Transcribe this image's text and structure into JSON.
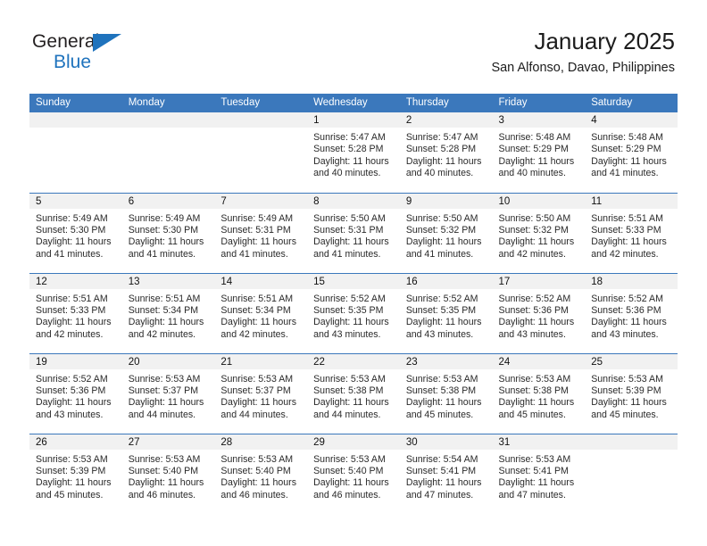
{
  "brand": {
    "name_line1": "General",
    "name_line2": "Blue",
    "triangle_icon": "triangle-icon",
    "color_dark": "#231f20",
    "color_blue": "#1f73bd"
  },
  "header": {
    "title": "January 2025",
    "subtitle": "San Alfonso, Davao, Philippines"
  },
  "theme": {
    "header_bg": "#3b78bc",
    "header_text": "#ffffff",
    "daynum_band_bg": "#f1f1f1",
    "cell_bg": "#ffffff",
    "divider": "#3b78bc"
  },
  "calendar": {
    "weekday_headers": [
      "Sunday",
      "Monday",
      "Tuesday",
      "Wednesday",
      "Thursday",
      "Friday",
      "Saturday"
    ],
    "weeks": [
      [
        {
          "day": "",
          "empty": true,
          "sunrise": "",
          "sunset": "",
          "daylight1": "",
          "daylight2": ""
        },
        {
          "day": "",
          "empty": true,
          "sunrise": "",
          "sunset": "",
          "daylight1": "",
          "daylight2": ""
        },
        {
          "day": "",
          "empty": true,
          "sunrise": "",
          "sunset": "",
          "daylight1": "",
          "daylight2": ""
        },
        {
          "day": "1",
          "empty": false,
          "sunrise": "Sunrise: 5:47 AM",
          "sunset": "Sunset: 5:28 PM",
          "daylight1": "Daylight: 11 hours",
          "daylight2": "and 40 minutes."
        },
        {
          "day": "2",
          "empty": false,
          "sunrise": "Sunrise: 5:47 AM",
          "sunset": "Sunset: 5:28 PM",
          "daylight1": "Daylight: 11 hours",
          "daylight2": "and 40 minutes."
        },
        {
          "day": "3",
          "empty": false,
          "sunrise": "Sunrise: 5:48 AM",
          "sunset": "Sunset: 5:29 PM",
          "daylight1": "Daylight: 11 hours",
          "daylight2": "and 40 minutes."
        },
        {
          "day": "4",
          "empty": false,
          "sunrise": "Sunrise: 5:48 AM",
          "sunset": "Sunset: 5:29 PM",
          "daylight1": "Daylight: 11 hours",
          "daylight2": "and 41 minutes."
        }
      ],
      [
        {
          "day": "5",
          "empty": false,
          "sunrise": "Sunrise: 5:49 AM",
          "sunset": "Sunset: 5:30 PM",
          "daylight1": "Daylight: 11 hours",
          "daylight2": "and 41 minutes."
        },
        {
          "day": "6",
          "empty": false,
          "sunrise": "Sunrise: 5:49 AM",
          "sunset": "Sunset: 5:30 PM",
          "daylight1": "Daylight: 11 hours",
          "daylight2": "and 41 minutes."
        },
        {
          "day": "7",
          "empty": false,
          "sunrise": "Sunrise: 5:49 AM",
          "sunset": "Sunset: 5:31 PM",
          "daylight1": "Daylight: 11 hours",
          "daylight2": "and 41 minutes."
        },
        {
          "day": "8",
          "empty": false,
          "sunrise": "Sunrise: 5:50 AM",
          "sunset": "Sunset: 5:31 PM",
          "daylight1": "Daylight: 11 hours",
          "daylight2": "and 41 minutes."
        },
        {
          "day": "9",
          "empty": false,
          "sunrise": "Sunrise: 5:50 AM",
          "sunset": "Sunset: 5:32 PM",
          "daylight1": "Daylight: 11 hours",
          "daylight2": "and 41 minutes."
        },
        {
          "day": "10",
          "empty": false,
          "sunrise": "Sunrise: 5:50 AM",
          "sunset": "Sunset: 5:32 PM",
          "daylight1": "Daylight: 11 hours",
          "daylight2": "and 42 minutes."
        },
        {
          "day": "11",
          "empty": false,
          "sunrise": "Sunrise: 5:51 AM",
          "sunset": "Sunset: 5:33 PM",
          "daylight1": "Daylight: 11 hours",
          "daylight2": "and 42 minutes."
        }
      ],
      [
        {
          "day": "12",
          "empty": false,
          "sunrise": "Sunrise: 5:51 AM",
          "sunset": "Sunset: 5:33 PM",
          "daylight1": "Daylight: 11 hours",
          "daylight2": "and 42 minutes."
        },
        {
          "day": "13",
          "empty": false,
          "sunrise": "Sunrise: 5:51 AM",
          "sunset": "Sunset: 5:34 PM",
          "daylight1": "Daylight: 11 hours",
          "daylight2": "and 42 minutes."
        },
        {
          "day": "14",
          "empty": false,
          "sunrise": "Sunrise: 5:51 AM",
          "sunset": "Sunset: 5:34 PM",
          "daylight1": "Daylight: 11 hours",
          "daylight2": "and 42 minutes."
        },
        {
          "day": "15",
          "empty": false,
          "sunrise": "Sunrise: 5:52 AM",
          "sunset": "Sunset: 5:35 PM",
          "daylight1": "Daylight: 11 hours",
          "daylight2": "and 43 minutes."
        },
        {
          "day": "16",
          "empty": false,
          "sunrise": "Sunrise: 5:52 AM",
          "sunset": "Sunset: 5:35 PM",
          "daylight1": "Daylight: 11 hours",
          "daylight2": "and 43 minutes."
        },
        {
          "day": "17",
          "empty": false,
          "sunrise": "Sunrise: 5:52 AM",
          "sunset": "Sunset: 5:36 PM",
          "daylight1": "Daylight: 11 hours",
          "daylight2": "and 43 minutes."
        },
        {
          "day": "18",
          "empty": false,
          "sunrise": "Sunrise: 5:52 AM",
          "sunset": "Sunset: 5:36 PM",
          "daylight1": "Daylight: 11 hours",
          "daylight2": "and 43 minutes."
        }
      ],
      [
        {
          "day": "19",
          "empty": false,
          "sunrise": "Sunrise: 5:52 AM",
          "sunset": "Sunset: 5:36 PM",
          "daylight1": "Daylight: 11 hours",
          "daylight2": "and 43 minutes."
        },
        {
          "day": "20",
          "empty": false,
          "sunrise": "Sunrise: 5:53 AM",
          "sunset": "Sunset: 5:37 PM",
          "daylight1": "Daylight: 11 hours",
          "daylight2": "and 44 minutes."
        },
        {
          "day": "21",
          "empty": false,
          "sunrise": "Sunrise: 5:53 AM",
          "sunset": "Sunset: 5:37 PM",
          "daylight1": "Daylight: 11 hours",
          "daylight2": "and 44 minutes."
        },
        {
          "day": "22",
          "empty": false,
          "sunrise": "Sunrise: 5:53 AM",
          "sunset": "Sunset: 5:38 PM",
          "daylight1": "Daylight: 11 hours",
          "daylight2": "and 44 minutes."
        },
        {
          "day": "23",
          "empty": false,
          "sunrise": "Sunrise: 5:53 AM",
          "sunset": "Sunset: 5:38 PM",
          "daylight1": "Daylight: 11 hours",
          "daylight2": "and 45 minutes."
        },
        {
          "day": "24",
          "empty": false,
          "sunrise": "Sunrise: 5:53 AM",
          "sunset": "Sunset: 5:38 PM",
          "daylight1": "Daylight: 11 hours",
          "daylight2": "and 45 minutes."
        },
        {
          "day": "25",
          "empty": false,
          "sunrise": "Sunrise: 5:53 AM",
          "sunset": "Sunset: 5:39 PM",
          "daylight1": "Daylight: 11 hours",
          "daylight2": "and 45 minutes."
        }
      ],
      [
        {
          "day": "26",
          "empty": false,
          "sunrise": "Sunrise: 5:53 AM",
          "sunset": "Sunset: 5:39 PM",
          "daylight1": "Daylight: 11 hours",
          "daylight2": "and 45 minutes."
        },
        {
          "day": "27",
          "empty": false,
          "sunrise": "Sunrise: 5:53 AM",
          "sunset": "Sunset: 5:40 PM",
          "daylight1": "Daylight: 11 hours",
          "daylight2": "and 46 minutes."
        },
        {
          "day": "28",
          "empty": false,
          "sunrise": "Sunrise: 5:53 AM",
          "sunset": "Sunset: 5:40 PM",
          "daylight1": "Daylight: 11 hours",
          "daylight2": "and 46 minutes."
        },
        {
          "day": "29",
          "empty": false,
          "sunrise": "Sunrise: 5:53 AM",
          "sunset": "Sunset: 5:40 PM",
          "daylight1": "Daylight: 11 hours",
          "daylight2": "and 46 minutes."
        },
        {
          "day": "30",
          "empty": false,
          "sunrise": "Sunrise: 5:54 AM",
          "sunset": "Sunset: 5:41 PM",
          "daylight1": "Daylight: 11 hours",
          "daylight2": "and 47 minutes."
        },
        {
          "day": "31",
          "empty": false,
          "sunrise": "Sunrise: 5:53 AM",
          "sunset": "Sunset: 5:41 PM",
          "daylight1": "Daylight: 11 hours",
          "daylight2": "and 47 minutes."
        },
        {
          "day": "",
          "empty": true,
          "sunrise": "",
          "sunset": "",
          "daylight1": "",
          "daylight2": ""
        }
      ]
    ]
  }
}
